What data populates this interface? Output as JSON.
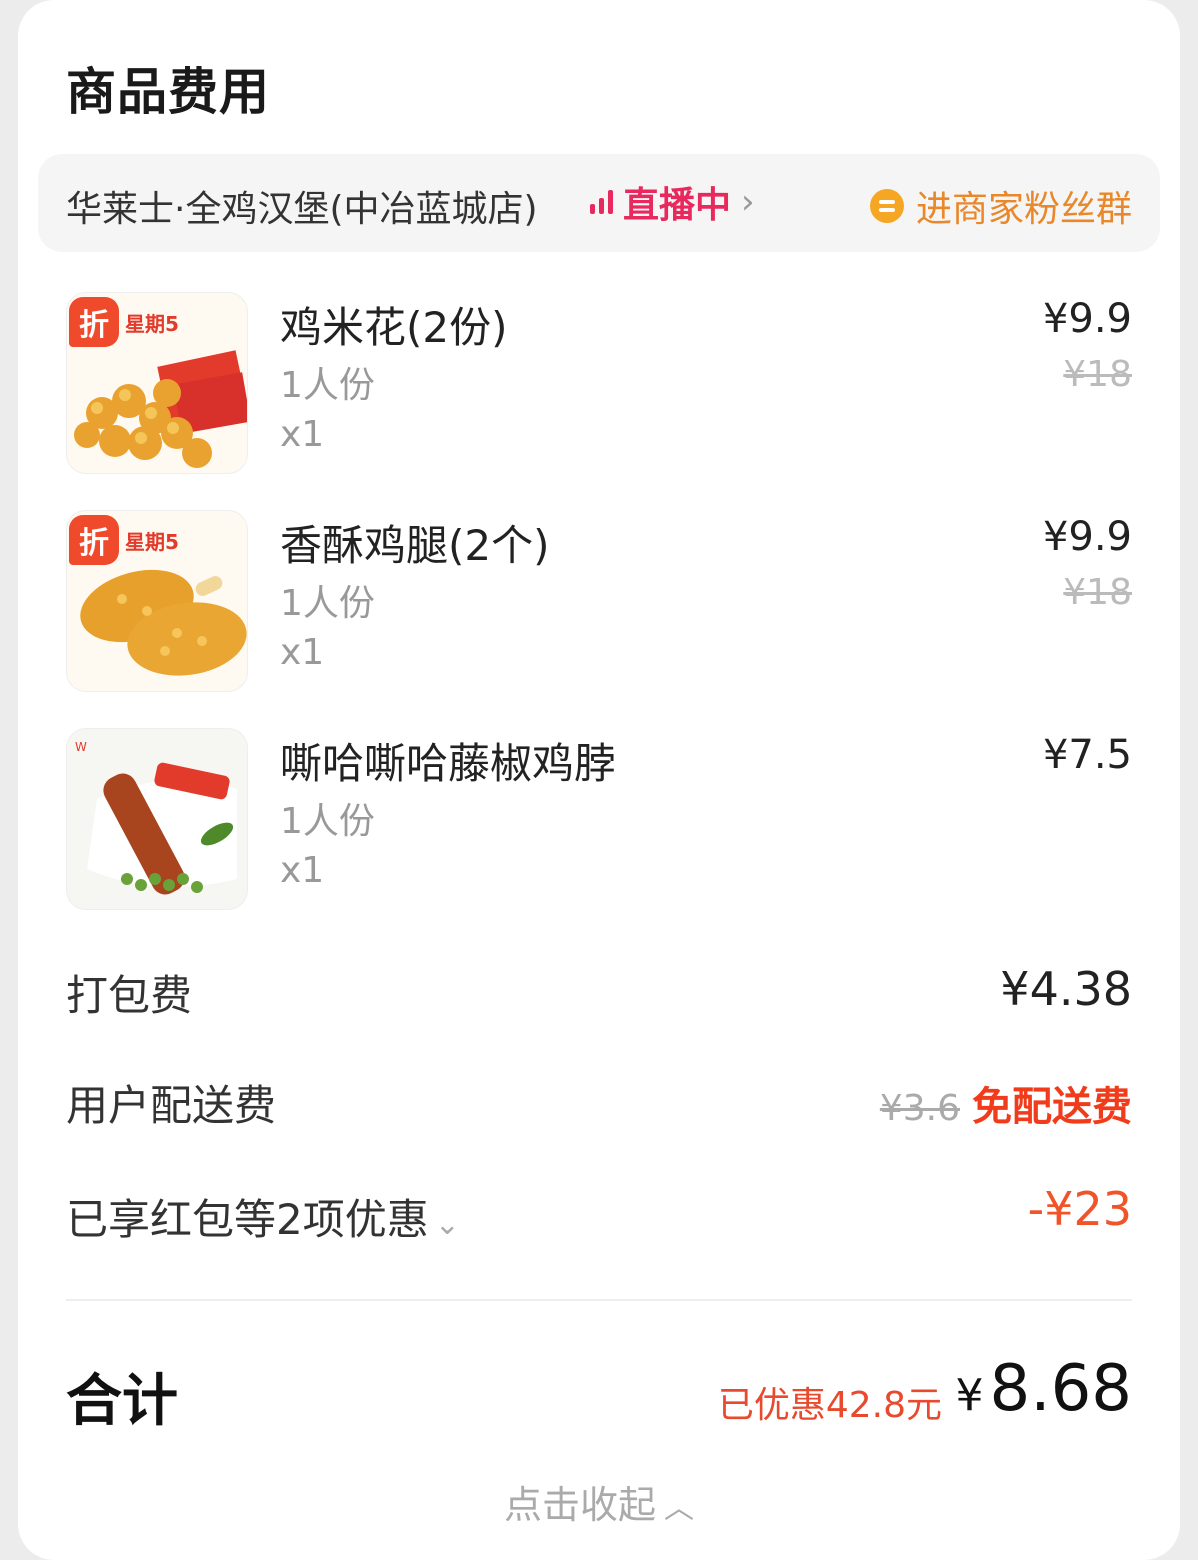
{
  "section": {
    "title": "商品费用"
  },
  "store": {
    "name": "华莱士·全鸡汉堡(中冶蓝城店)",
    "live_label": "直播中",
    "fans_label": "进商家粉丝群"
  },
  "items": [
    {
      "name": "鸡米花(2份)",
      "spec": "1人份",
      "qty": "x1",
      "price": "¥9.9",
      "original_price": "¥18",
      "badge": "折"
    },
    {
      "name": "香酥鸡腿(2个)",
      "spec": "1人份",
      "qty": "x1",
      "price": "¥9.9",
      "original_price": "¥18",
      "badge": "折"
    },
    {
      "name": "嘶哈嘶哈藤椒鸡脖",
      "spec": "1人份",
      "qty": "x1",
      "price": "¥7.5"
    }
  ],
  "packing": {
    "label": "打包费",
    "value": "¥4.38"
  },
  "delivery": {
    "label": "用户配送费",
    "original": "¥3.6",
    "value": "免配送费"
  },
  "discount": {
    "label": "已享红包等2项优惠",
    "value": "-¥23"
  },
  "total": {
    "label": "合计",
    "saved": "已优惠42.8元",
    "currency": "¥",
    "amount": "8.68"
  },
  "collapse": {
    "label": "点击收起"
  },
  "colors": {
    "live": "#e8295d",
    "fans": "#e8882a",
    "discount": "#f0552a",
    "free": "#f03c1a"
  }
}
